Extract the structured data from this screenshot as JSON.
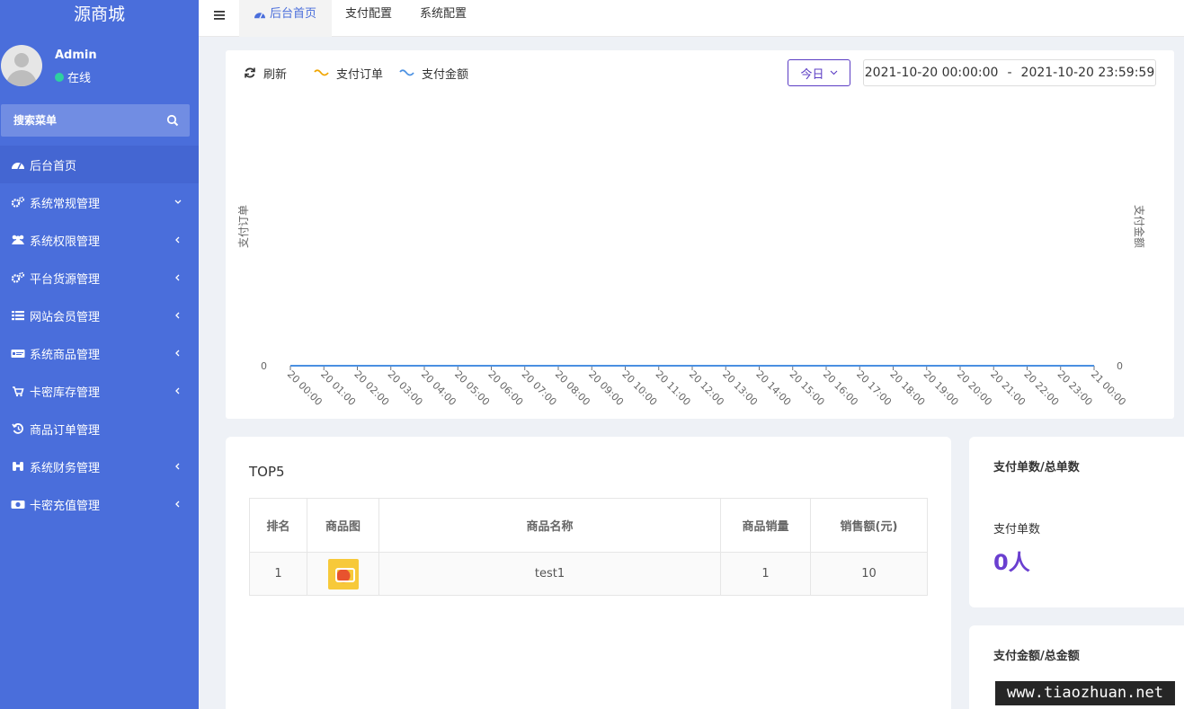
{
  "brand": "源商城",
  "user": {
    "name": "Admin",
    "status": "在线"
  },
  "search": {
    "placeholder": "搜索菜单"
  },
  "menu": [
    {
      "label": "后台首页",
      "icon": "dashboard-icon",
      "arrow": "none"
    },
    {
      "label": "系统常规管理",
      "icon": "cogs-icon",
      "arrow": "chevron-down"
    },
    {
      "label": "系统权限管理",
      "icon": "users-icon",
      "arrow": "chevron-left"
    },
    {
      "label": "平台货源管理",
      "icon": "cogs-icon",
      "arrow": "chevron-left"
    },
    {
      "label": "网站会员管理",
      "icon": "list-icon",
      "arrow": "chevron-left"
    },
    {
      "label": "系统商品管理",
      "icon": "card-icon",
      "arrow": "chevron-left"
    },
    {
      "label": "卡密库存管理",
      "icon": "cart-icon",
      "arrow": "chevron-left"
    },
    {
      "label": "商品订单管理",
      "icon": "history-icon",
      "arrow": "none"
    },
    {
      "label": "系统财务管理",
      "icon": "binoculars-icon",
      "arrow": "chevron-left"
    },
    {
      "label": "卡密充值管理",
      "icon": "money-icon",
      "arrow": "chevron-left"
    }
  ],
  "tabs": [
    {
      "label": "后台首页"
    },
    {
      "label": "支付配置"
    },
    {
      "label": "系统配置"
    }
  ],
  "toolbar": {
    "refresh_label": "刷新",
    "legend_orders": "支付订单",
    "legend_amount": "支付金额",
    "range_select": "今日",
    "date_start": "2021-10-20 00:00:00",
    "date_sep": "-",
    "date_end": "2021-10-20 23:59:59"
  },
  "colors": {
    "sidebar": "#4a6edb",
    "orders_series": "#f0a500",
    "amount_series": "#4a90e2",
    "accent": "#6a3fd0"
  },
  "chart_data": {
    "type": "line",
    "x": [
      "20 00:00",
      "20 01:00",
      "20 02:00",
      "20 03:00",
      "20 04:00",
      "20 05:00",
      "20 06:00",
      "20 07:00",
      "20 08:00",
      "20 09:00",
      "20 10:00",
      "20 11:00",
      "20 12:00",
      "20 13:00",
      "20 14:00",
      "20 15:00",
      "20 16:00",
      "20 17:00",
      "20 18:00",
      "20 19:00",
      "20 20:00",
      "20 21:00",
      "20 22:00",
      "20 23:00",
      "21 00:00"
    ],
    "series": [
      {
        "name": "支付订单",
        "values": [
          0,
          0,
          0,
          0,
          0,
          0,
          0,
          0,
          0,
          0,
          0,
          0,
          0,
          0,
          0,
          0,
          0,
          0,
          0,
          0,
          0,
          0,
          0,
          0,
          0
        ]
      },
      {
        "name": "支付金额",
        "values": [
          0,
          0,
          0,
          0,
          0,
          0,
          0,
          0,
          0,
          0,
          0,
          0,
          0,
          0,
          0,
          0,
          0,
          0,
          0,
          0,
          0,
          0,
          0,
          0,
          0
        ]
      }
    ],
    "ylabel_left": "支付订单",
    "ylabel_right": "支付金额",
    "y_ticks_left": [
      "0"
    ],
    "y_ticks_right": [
      "0"
    ],
    "grid": false
  },
  "top5": {
    "title": "TOP5",
    "headers": [
      "排名",
      "商品图",
      "商品名称",
      "商品销量",
      "销售额(元)"
    ],
    "rows": [
      {
        "rank": "1",
        "name": "test1",
        "sales": "1",
        "revenue": "10"
      }
    ]
  },
  "stats": {
    "orders_title": "支付单数/总单数",
    "orders_label": "支付单数",
    "orders_value": "0人",
    "amount_title": "支付金额/总金额"
  },
  "watermark": "www.tiaozhuan.net"
}
